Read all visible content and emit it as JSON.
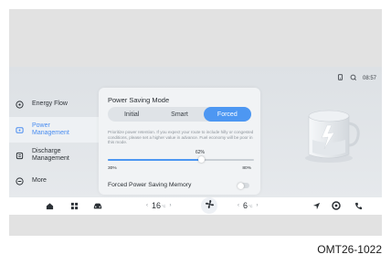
{
  "status_bar": {
    "time": "08:57"
  },
  "sidebar": {
    "items": [
      {
        "label": "Energy Flow",
        "icon": "energy-flow-icon",
        "active": false
      },
      {
        "label": "Power\nManagement",
        "icon": "power-icon",
        "active": true
      },
      {
        "label": "Discharge\nManagement",
        "icon": "discharge-icon",
        "active": false
      },
      {
        "label": "More",
        "icon": "more-icon",
        "active": false
      }
    ]
  },
  "power_saving": {
    "title": "Power Saving Mode",
    "modes": [
      "Initial",
      "Smart",
      "Forced"
    ],
    "selected_mode": "Forced",
    "description": "Prioritize power retention. If you expect your route to include hilly or congested conditions, please set a higher value in advance. Fuel economy will be poor in this mode.",
    "slider": {
      "value_label": "62%",
      "value": 62,
      "min_label": "30%",
      "max_label": "80%",
      "min": 30,
      "max": 80
    },
    "forced_memory_label": "Forced Power Saving Memory",
    "forced_memory_on": false
  },
  "dock": {
    "left_temp": "16",
    "right_temp": "6",
    "temp_unit": "°C"
  },
  "colors": {
    "accent": "#4d97f2",
    "screen_bg": "#e4e7ea"
  },
  "figure_code": "OMT26-1022"
}
